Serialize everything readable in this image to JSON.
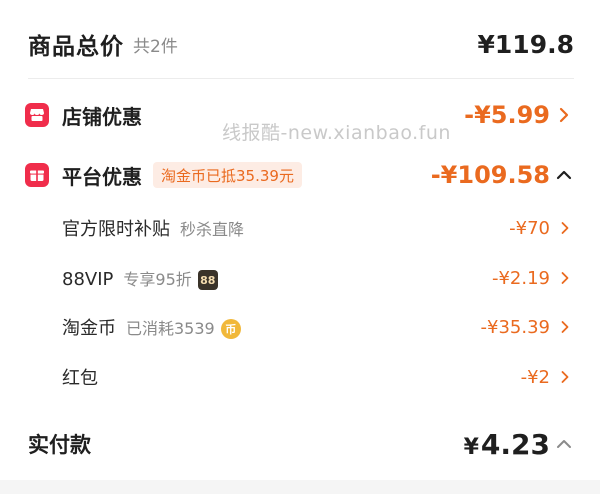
{
  "summary": {
    "title": "商品总价",
    "count": "共2件",
    "total": "¥119.8"
  },
  "watermark": "线报酷-new.xianbao.fun",
  "shop_discount": {
    "label": "店铺优惠",
    "amount": "-¥5.99",
    "icon": "shop-icon"
  },
  "platform_discount": {
    "label": "平台优惠",
    "tag": "淘金币已抵35.39元",
    "amount": "-¥109.58",
    "icon": "gift-icon",
    "items": [
      {
        "label": "官方限时补贴",
        "note": "秒杀直降",
        "badge": "",
        "amount": "-¥70"
      },
      {
        "label": "88VIP",
        "note": "专享95折",
        "badge": "88",
        "amount": "-¥2.19"
      },
      {
        "label": "淘金币",
        "note": "已消耗3539",
        "badge": "币",
        "amount": "-¥35.39"
      },
      {
        "label": "红包",
        "note": "",
        "badge": "",
        "amount": "-¥2"
      }
    ]
  },
  "payment": {
    "label": "实付款",
    "currency": "¥",
    "amount": "4.23"
  },
  "colors": {
    "accent": "#ea6a1f",
    "icon_red": "#f02d4b",
    "tag_bg": "#fdece4"
  }
}
